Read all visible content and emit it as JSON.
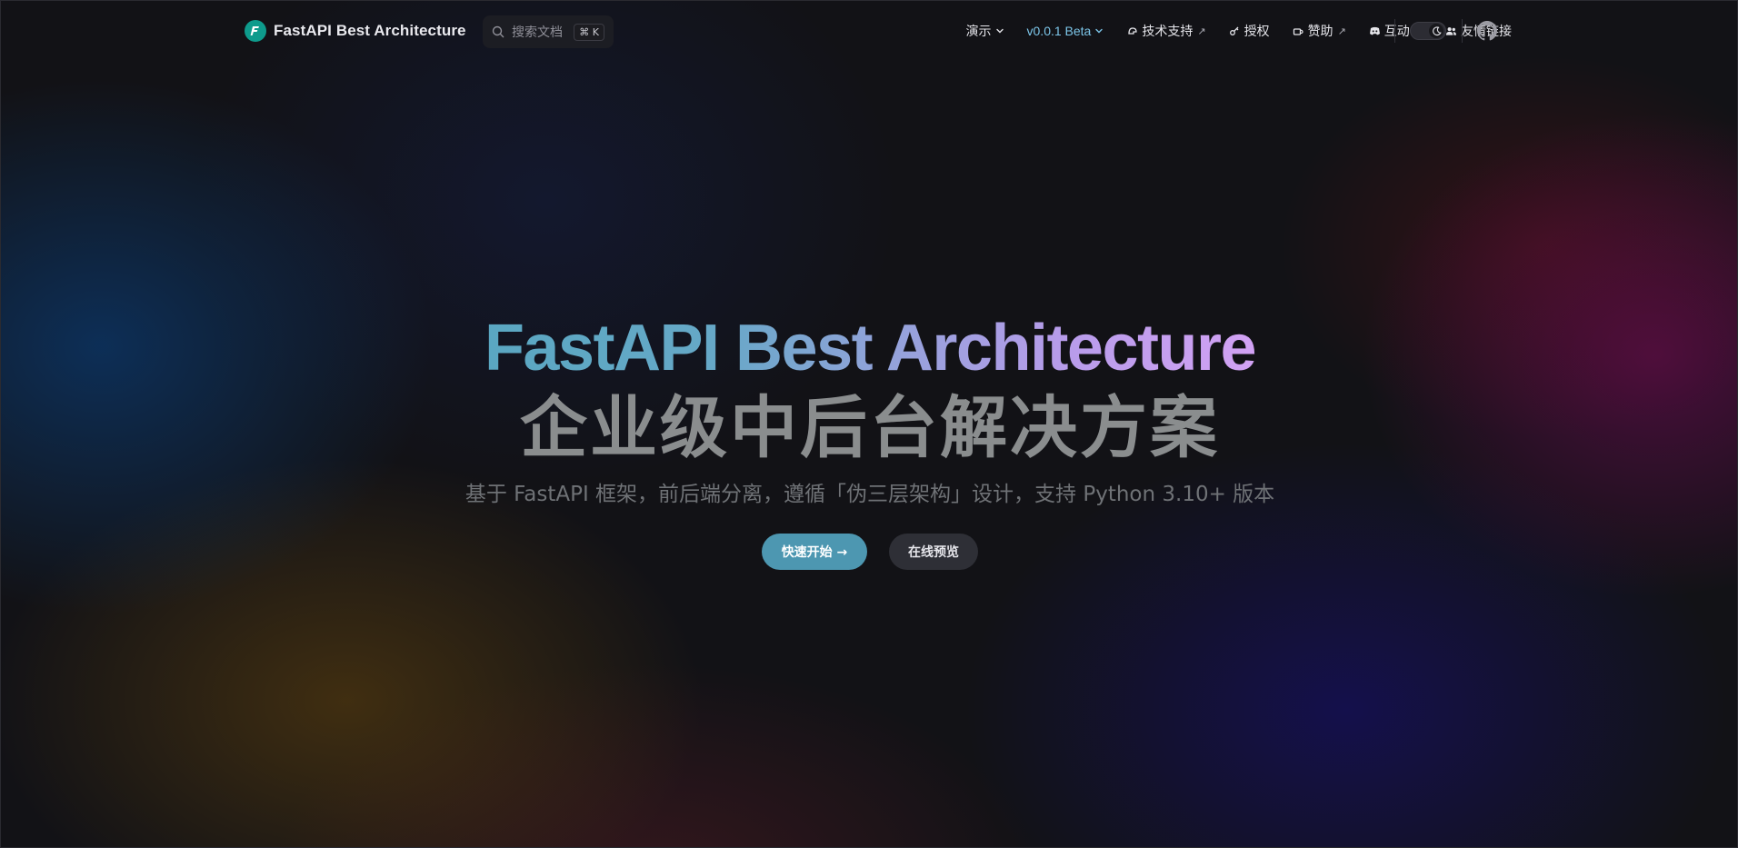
{
  "nav": {
    "brand": {
      "name": "FastAPI Best Architecture",
      "logo_letter": "F",
      "logo_color": "#0e9b8c"
    },
    "search": {
      "placeholder": "搜索文档",
      "shortcut": "⌘ K"
    },
    "items": [
      {
        "label": "演示",
        "icon": "",
        "suffix": "chevron-down"
      },
      {
        "label": "v0.0.1 Beta",
        "icon": "",
        "suffix": "chevron-down",
        "accent": true
      },
      {
        "label": "技术支持",
        "icon": "support-icon",
        "suffix": "external"
      },
      {
        "label": "授权",
        "icon": "key-icon",
        "suffix": ""
      },
      {
        "label": "赞助",
        "icon": "coffee-icon",
        "suffix": "external"
      },
      {
        "label": "互动",
        "icon": "discord-icon",
        "suffix": "external"
      },
      {
        "label": "友情链接",
        "icon": "users-icon",
        "suffix": ""
      }
    ],
    "external_glyph": "↗",
    "theme_toggle": {
      "mode": "dark",
      "icon": "moon-icon"
    },
    "github": {
      "icon": "github-icon"
    }
  },
  "hero": {
    "title": "FastAPI Best Architecture",
    "subtitle": "企业级中后台解决方案",
    "description": "基于 FastAPI 框架，前后端分离，遵循「伪三层架构」设计，支持 Python 3.10+ 版本",
    "primary_button": "快速开始 →",
    "secondary_button": "在线预览"
  },
  "colors": {
    "accent": "#7cc5e8",
    "primary_button": "#4d97b1",
    "title_gradient_start": "#5aa7c2",
    "title_gradient_end": "#d2a2f4"
  }
}
